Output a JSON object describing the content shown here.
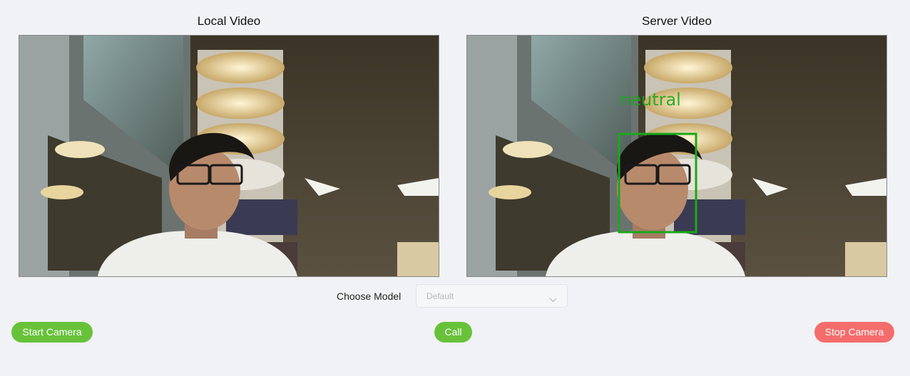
{
  "local_panel": {
    "title": "Local Video"
  },
  "server_panel": {
    "title": "Server Video",
    "overlay_label": "neutral",
    "overlay_color": "#1aa81a"
  },
  "model_select": {
    "label": "Choose Model",
    "value": "Default",
    "arrow_icon": "chevron-down-icon"
  },
  "buttons": {
    "start_camera": "Start Camera",
    "call": "Call",
    "stop_camera": "Stop Camera"
  },
  "colors": {
    "accent_green": "#67c23a",
    "accent_red": "#f56c6c",
    "background": "#f1f2f5"
  }
}
